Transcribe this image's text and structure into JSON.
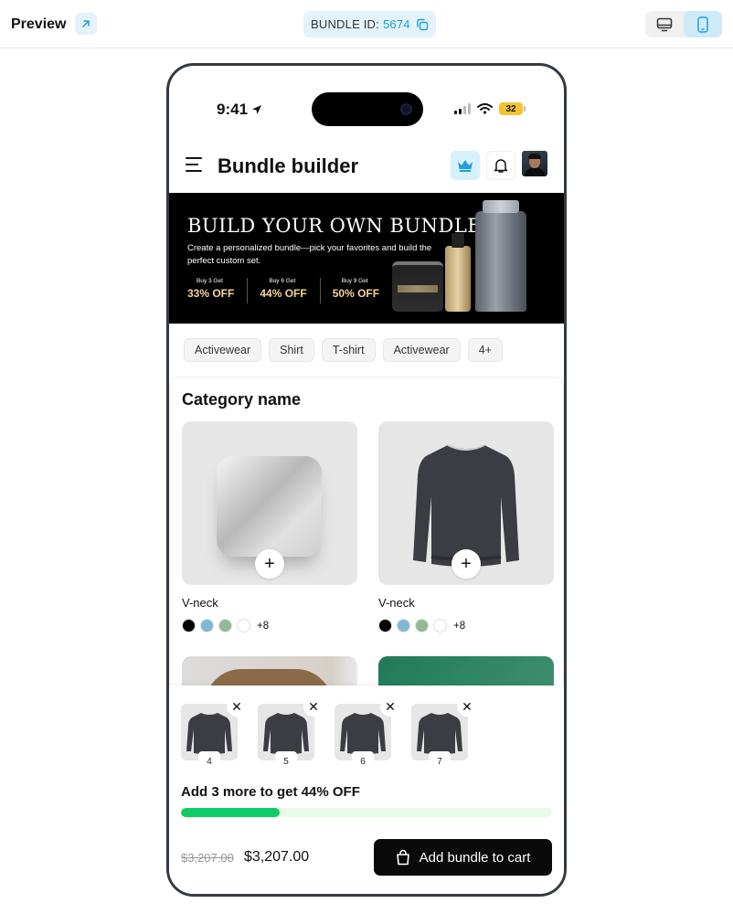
{
  "topbar": {
    "preview_label": "Preview",
    "bundle_id_label": "BUNDLE ID:",
    "bundle_id_value": "5674"
  },
  "status": {
    "time": "9:41",
    "battery": "32"
  },
  "header": {
    "title": "Bundle builder"
  },
  "banner": {
    "title": "BUILD YOUR OWN BUNDLE.",
    "subtitle": "Create a personalized bundle—pick your favorites and build the perfect custom set.",
    "offers": [
      {
        "small": "Buy 3 Get",
        "big": "33% OFF"
      },
      {
        "small": "Buy 6 Get",
        "big": "44% OFF"
      },
      {
        "small": "Buy 9 Get",
        "big": "50% OFF"
      }
    ]
  },
  "chips": [
    "Activewear",
    "Shirt",
    "T-shirt",
    "Activewear",
    "4+"
  ],
  "category": {
    "title": "Category name",
    "products": [
      {
        "name": "V-neck",
        "more": "+8",
        "swatches": [
          "#000000",
          "#7fb8d6",
          "#93b896",
          "#ffffff"
        ]
      },
      {
        "name": "V-neck",
        "more": "+8",
        "swatches": [
          "#000000",
          "#7fb8d6",
          "#93b896",
          "#ffffff"
        ]
      }
    ]
  },
  "tray": {
    "items": [
      {
        "num": "4",
        "close": "✕"
      },
      {
        "num": "5",
        "close": "✕"
      },
      {
        "num": "6",
        "close": "✕"
      },
      {
        "num": "7",
        "close": "✕"
      }
    ],
    "promo": "Add 3 more to get 44% OFF",
    "progress": 0.265,
    "old_price": "$3,207.00",
    "new_price": "$3,207.00",
    "cart_label": "Add bundle to cart"
  },
  "colors": {
    "accent": "#1ea0dc",
    "progress_fill": "#0fcc68",
    "offer_gold": "#f2d49a"
  }
}
